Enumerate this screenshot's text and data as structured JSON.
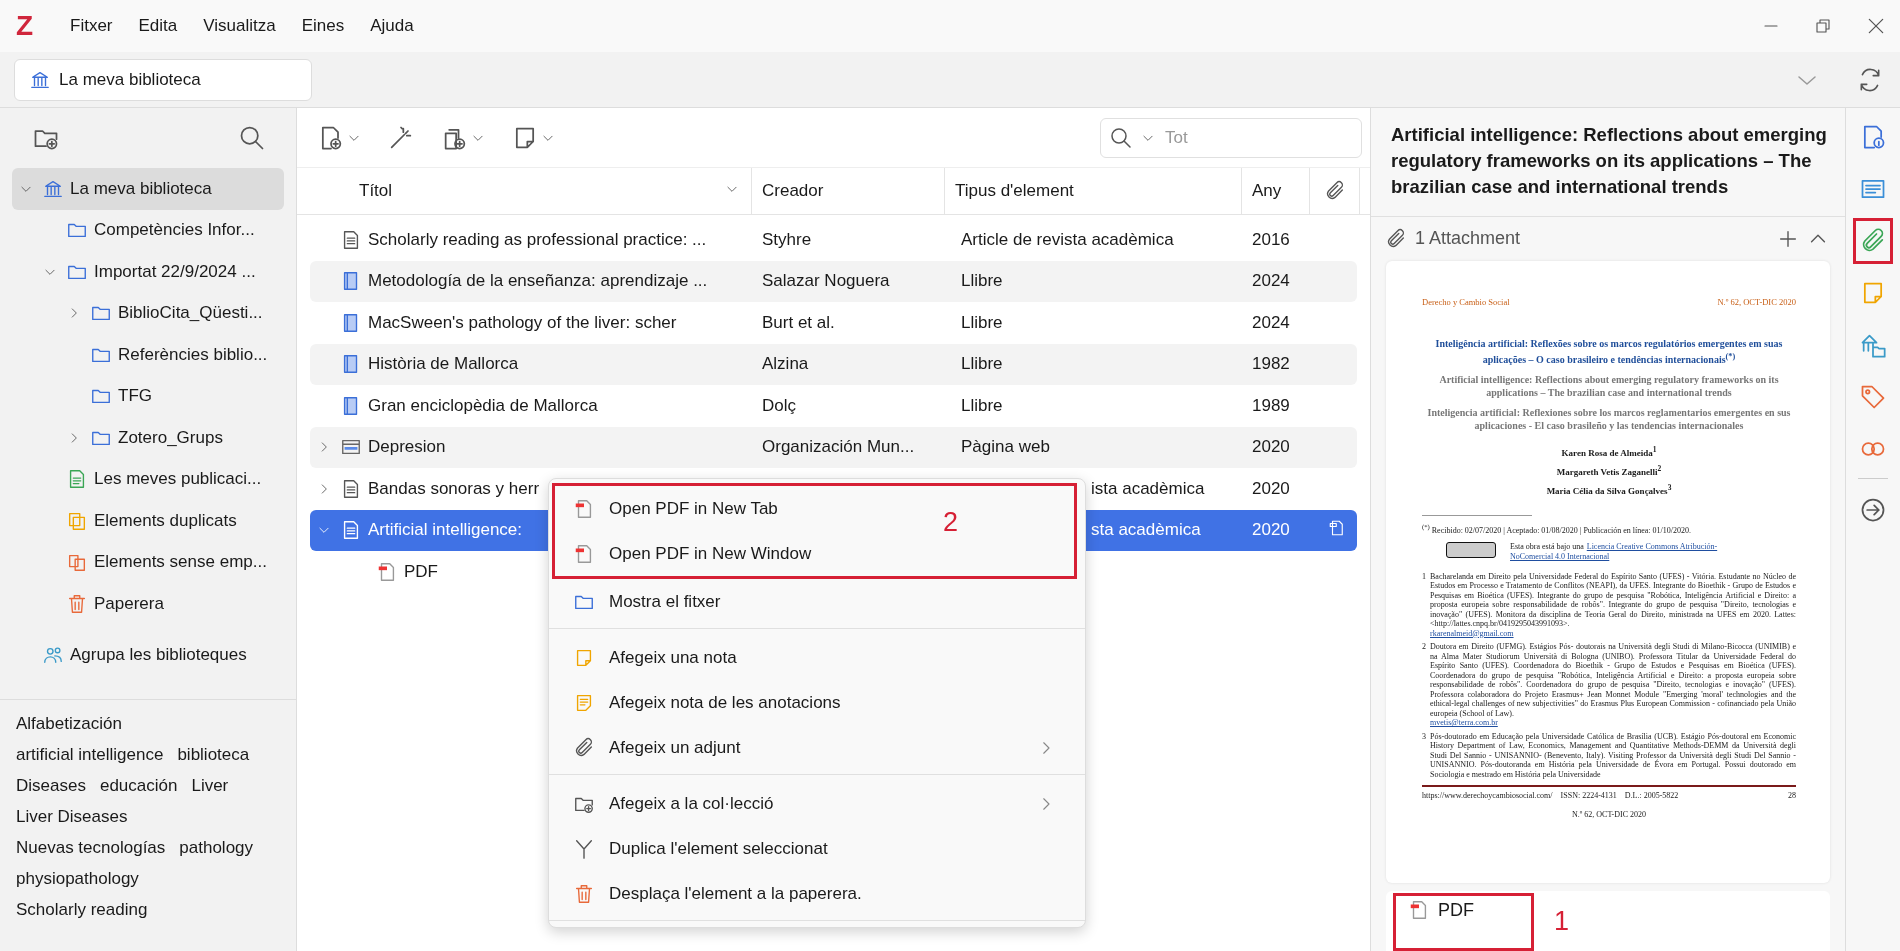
{
  "app": {
    "logo": "Z"
  },
  "menu": [
    "Fitxer",
    "Edita",
    "Visualitza",
    "Eines",
    "Ajuda"
  ],
  "library_tab": {
    "label": "La meva biblioteca",
    "selected": true
  },
  "collections": [
    {
      "label": "La meva biblioteca",
      "kind": "library",
      "selected": true,
      "expandable": true,
      "expanded": true,
      "children": [
        {
          "label": "Competències Infor...",
          "kind": "folder",
          "selected": false
        },
        {
          "label": "Importat 22/9/2024 ...",
          "kind": "folder",
          "selected": false,
          "expandable": true,
          "expanded": true,
          "children": [
            {
              "label": "BiblioCita_Qüesti...",
              "kind": "folder",
              "selected": false,
              "expandable": true,
              "expanded": false
            },
            {
              "label": "Referències biblio...",
              "kind": "folder",
              "selected": false
            },
            {
              "label": "TFG",
              "kind": "folder",
              "selected": false
            },
            {
              "label": "Zotero_Grups",
              "kind": "folder",
              "selected": false,
              "expandable": true,
              "expanded": false
            }
          ]
        },
        {
          "label": "Les meves publicaci...",
          "kind": "publications",
          "selected": false
        },
        {
          "label": "Elements duplicats",
          "kind": "duplicates",
          "selected": false
        },
        {
          "label": "Elements sense emp...",
          "kind": "unfiled",
          "selected": false
        },
        {
          "label": "Paperera",
          "kind": "trash",
          "selected": false
        }
      ]
    },
    {
      "label": "Agrupa les biblioteques",
      "kind": "groups",
      "selected": false
    }
  ],
  "tags": [
    "Alfabetización",
    "artificial intelligence",
    "biblioteca",
    "Diseases",
    "educación",
    "Liver",
    "Liver Diseases",
    "Nuevas tecnologías",
    "pathology",
    "physiopathology",
    "Scholarly reading"
  ],
  "search": {
    "placeholder": "Tot"
  },
  "columns": [
    {
      "label": "Títol",
      "sorted": true
    },
    {
      "label": "Creador",
      "sorted": false
    },
    {
      "label": "Tipus d'element",
      "sorted": false
    },
    {
      "label": "Any",
      "sorted": false
    }
  ],
  "rows": [
    {
      "kind": "article",
      "title": "Scholarly reading as professional practice: ...",
      "creator": "Styhre",
      "type": "Article de revista acadèmica",
      "year": "2016",
      "selected": false
    },
    {
      "kind": "book",
      "title": "Metodología de la enseñanza: aprendizaje ...",
      "creator": "Salazar Noguera",
      "type": "Llibre",
      "year": "2024",
      "selected": false
    },
    {
      "kind": "book",
      "title": "MacSween's pathology of the liver: scher",
      "creator": "Burt et al.",
      "type": "Llibre",
      "year": "2024",
      "selected": false
    },
    {
      "kind": "book",
      "title": "Història de Mallorca",
      "creator": "Alzina",
      "type": "Llibre",
      "year": "1982",
      "selected": false
    },
    {
      "kind": "book",
      "title": "Gran enciclopèdia de Mallorca",
      "creator": "Dolç",
      "type": "Llibre",
      "year": "1989",
      "selected": false
    },
    {
      "kind": "webpage",
      "title": "Depresion",
      "creator": "Organización Mun...",
      "type": "Pàgina web",
      "year": "2020",
      "selected": false,
      "expandable": true,
      "expanded": false
    },
    {
      "kind": "article",
      "title": "Bandas sonoras y herr",
      "type": "ista acadèmica",
      "year": "2020",
      "selected": false,
      "expandable": true,
      "expanded": false
    },
    {
      "kind": "article",
      "title": "Artificial intelligence:",
      "type": "sta acadèmica",
      "year": "2020",
      "selected": true,
      "expandable": true,
      "expanded": true,
      "attachment": true,
      "children": [
        {
          "kind": "pdf",
          "title": "PDF",
          "selected": false
        }
      ]
    }
  ],
  "context_menu": {
    "sections": [
      {
        "marker": "2",
        "separator": false,
        "items": [
          {
            "kind": "pdf",
            "label": "Open PDF in New Tab",
            "submenu": false
          },
          {
            "kind": "pdf",
            "label": "Open PDF in New Window",
            "submenu": false
          }
        ]
      },
      {
        "separator": true,
        "items": [
          {
            "kind": "folder",
            "label": "Mostra el fitxer",
            "submenu": false
          }
        ]
      },
      {
        "separator": true,
        "items": [
          {
            "kind": "note",
            "label": "Afegeix una nota",
            "submenu": false
          },
          {
            "kind": "annotation-note",
            "label": "Afegeix nota de les anotacions",
            "submenu": false
          },
          {
            "kind": "attach",
            "label": "Afegeix un adjunt",
            "submenu": true
          }
        ]
      },
      {
        "separator": true,
        "items": [
          {
            "kind": "add-collection",
            "label": "Afegeix a la col·lecció",
            "submenu": true
          },
          {
            "kind": "duplicate",
            "label": "Duplica l'element seleccionat",
            "submenu": false
          },
          {
            "kind": "trash",
            "label": "Desplaça l'element a la paperera.",
            "submenu": false
          }
        ]
      }
    ]
  },
  "item_pane": {
    "title": "Artificial intelligence: Reflections about emerging regulatory frameworks on its applications – The brazilian case and international trends",
    "attachments": {
      "heading": "1 Attachment",
      "file": {
        "label": "PDF",
        "marker": "1"
      },
      "preview": {
        "journal": "Derecho y Cambio Social",
        "issue": "N.º 62, OCT-DIC 2020",
        "title": "Inteligência artificial: Reflexões sobre os marcos regulatórios emergentes em suas aplicações – O caso brasileiro e tendências internacionais$^{(*)}$",
        "subtitles": [
          "Artificial intelligence: Reflections about emerging regulatory frameworks on its applications – The brazilian case and international trends",
          "Inteligencia artificial: Reflexiones sobre los marcos reglamentarios emergentes en sus aplicaciones - El caso brasileño y las tendencias internacionales"
        ],
        "authors": [
          "Karen Rosa de Almeida$^{1}$",
          "Margareth Vetis Zaganelli$^{2}$",
          "Maria Célia da Silva Gonçalves$^{3}$"
        ],
        "received": "$^{(*)}$ Recibido: 02/07/2020 | Aceptado: 01/08/2020 | Publicación en línea: 01/10/2020.",
        "license": {
          "text": "Esta obra está bajo una",
          "links": [
            "Licencia Creative Commons Atribución-",
            "NoComercial 4.0 Internacional"
          ]
        },
        "footnotes": [
          {
            "mark": "1",
            "text": "Bacharelanda em Direito pela Universidade Federal do Espírito Santo (UFES) - Vitória. Estudante no Núcleo de Estudos em Processo e Tratamento de Conflitos (NEAPI), da UFES. Integrante do Bioethik - Grupo de Estudos e Pesquisas em Bioética (UFES). Integrante do grupo de pesquisa \"Robótica, Inteligência Artificial e Direito: a proposta europeia sobre responsabilidade de robôs\". Integrante do grupo de pesquisa \"Direito, tecnologias e inovação\" (UFES). Monitora da disciplina de Teoria Geral do Direito, ministrada na UFES em 2020. Lattes: <http://lattes.cnpq.br/0419295043991093>.",
            "email": "rkarenalmeid@gmail.com"
          },
          {
            "mark": "2",
            "text": "Doutora em Direito (UFMG). Estágios Pós- doutorais na Università degli Studi di Milano-Bicocca (UNIMIB) e na Alma Mater Studiorum Università di Bologna (UNIBO). Professora Titular da Universidade Federal do Espírito Santo (UFES). Coordenadora do Bioethik - Grupo de Estudos e Pesquisas em Bioética (UFES). Coordenadora do grupo de pesquisa \"Robótica, Inteligência Artificial e Direito: a proposta europeia sobre responsabilidade de robôs\". Coordenadora do grupo de pesquisa \"Direito, tecnologias e inovação\" (UFES). Professora colaboradora do Projeto Erasmus+ Jean Monnet Module \"Emerging 'moral' technologies and the ethical-legal challenges of new subjectivities\" do Erasmus Plus European Commission - cofinanciado pela União europeia (School of Law).",
            "email": "mvetis@terra.com.br"
          },
          {
            "mark": "3",
            "text": "Pós-doutorado em Educação pela Universidade Católica de Brasília (UCB). Estágio Pós-doutoral em Economic History Department of Law, Economics, Management and Quantitative Methods-DEMM da Università degli Studi Del Sannio - UNISANNIO- (Benevento, Italy). Visiting Professor da Università degli Studi Del Sannio - UNISANNIO. Pós-doutoranda em História pela Universidade de Évora em Portugal. Possui doutorado em Sociologia e mestrado em História pela Universidade"
          }
        ],
        "footer": [
          "https://www.derechoycambiosocial.com/",
          "ISSN: 2224-4131",
          "D.L.: 2005-5822",
          "28"
        ],
        "footer_issue": "N.º 62, OCT-DIC 2020"
      }
    }
  },
  "side_icons": [
    {
      "kind": "info",
      "highlighted": false
    },
    {
      "kind": "abstract",
      "highlighted": false
    },
    {
      "kind": "attachments",
      "highlighted": true
    },
    {
      "kind": "notes",
      "highlighted": false
    },
    {
      "kind": "libraries",
      "highlighted": false
    },
    {
      "kind": "tags",
      "highlighted": false
    },
    {
      "kind": "related",
      "highlighted": false
    },
    {
      "kind": "locate",
      "highlighted": false
    }
  ]
}
